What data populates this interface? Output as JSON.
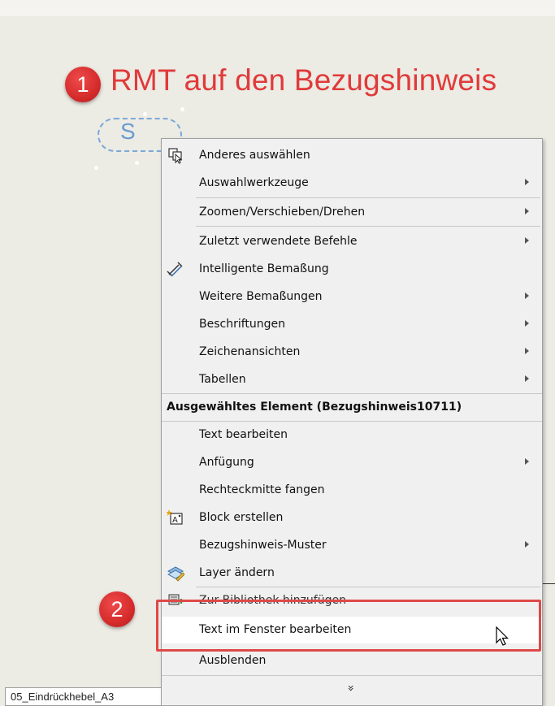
{
  "annotation": {
    "step1_number": "1",
    "step1_text": "RMT auf den Bezugshinweis",
    "step2_number": "2",
    "color": "#e03a3a"
  },
  "balloon": {
    "letter": "S"
  },
  "document_tab": {
    "label": "05_Eindrückhebel_A3"
  },
  "context_menu": {
    "items": [
      {
        "label": "Anderes auswählen",
        "icon": "select-other-icon",
        "submenu": false
      },
      {
        "label": "Auswahlwerkzeuge",
        "submenu": true
      },
      {
        "label": "Zoomen/Verschieben/Drehen",
        "submenu": true
      },
      {
        "label": "Zuletzt verwendete Befehle",
        "submenu": true
      },
      {
        "label": "Intelligente Bemaßung",
        "icon": "smart-dimension-icon",
        "submenu": false
      },
      {
        "label": "Weitere Bemaßungen",
        "submenu": true
      },
      {
        "label": "Beschriftungen",
        "submenu": true
      },
      {
        "label": "Zeichenansichten",
        "submenu": true
      },
      {
        "label": "Tabellen",
        "submenu": true
      }
    ],
    "section_header": "Ausgewähltes Element (Bezugshinweis10711)",
    "element_items": [
      {
        "label": "Text bearbeiten",
        "submenu": false
      },
      {
        "label": "Anfügung",
        "submenu": true
      },
      {
        "label": "Rechteckmitte fangen",
        "submenu": false
      },
      {
        "label": "Block erstellen",
        "icon": "make-block-icon",
        "submenu": false
      },
      {
        "label": "Bezugshinweis-Muster",
        "submenu": true
      },
      {
        "label": "Layer ändern",
        "icon": "change-layer-icon",
        "submenu": false
      },
      {
        "label": "Zur Bibliothek hinzufügen",
        "icon": "add-to-library-icon",
        "submenu": false
      },
      {
        "label": "Text im Fenster bearbeiten",
        "submenu": false,
        "highlighted": true
      },
      {
        "label": "Ausblenden",
        "submenu": false
      }
    ],
    "expand_glyph": "»"
  }
}
